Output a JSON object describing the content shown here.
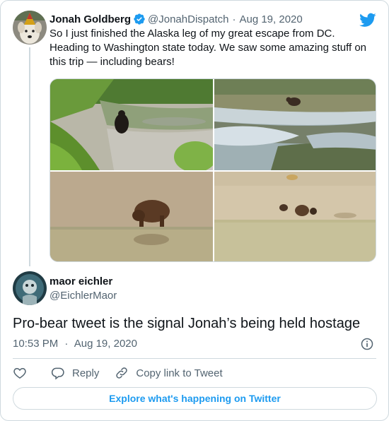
{
  "tweet": {
    "author_name": "Jonah Goldberg",
    "author_handle": "@JonahDispatch",
    "separator": "·",
    "date": "Aug 19, 2020",
    "text": "So I just finished the Alaska leg of my great escape from DC. Heading to Washington state today. We saw some amazing stuff on this trip — including bears!",
    "verified": true
  },
  "reply": {
    "author_name": "maor eichler",
    "author_handle": "@EichlerMaor",
    "text": "Pro-bear tweet is the signal Jonah’s being held hostage",
    "time": "10:53 PM",
    "separator": "·",
    "date": "Aug 19, 2020"
  },
  "actions": {
    "reply_label": "Reply",
    "copy_link_label": "Copy link to Tweet"
  },
  "explore_label": "Explore what's happening on Twitter",
  "colors": {
    "brand_blue": "#1d9bf0",
    "text_primary": "#0f1419",
    "text_secondary": "#536471",
    "border": "#cfd9de"
  },
  "icons": [
    "twitter-bird-icon",
    "verified-badge-icon",
    "info-icon",
    "heart-icon",
    "reply-icon",
    "copy-link-icon"
  ]
}
